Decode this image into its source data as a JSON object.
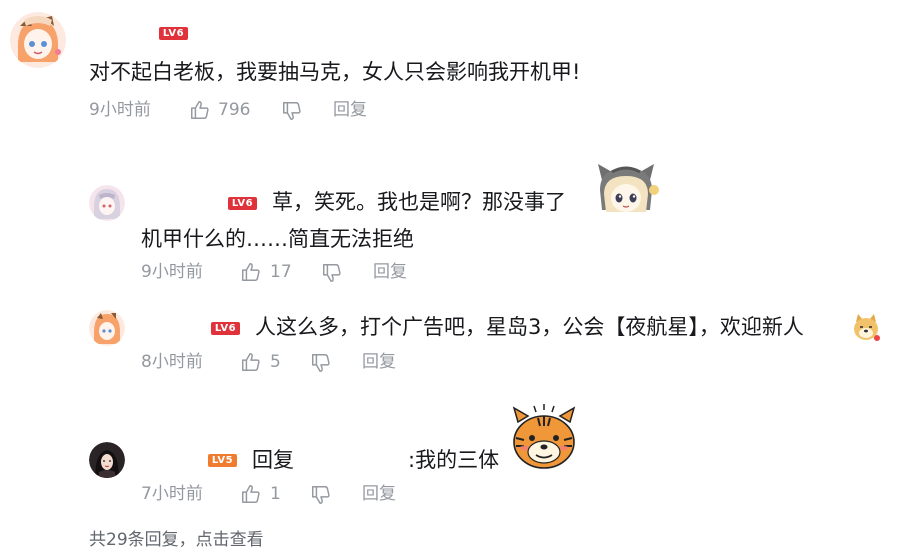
{
  "main_comment": {
    "level": "LV6",
    "text": "对不起白老板，我要抽马克，女人只会影响我开机甲!",
    "time": "9小时前",
    "likes": "796",
    "reply_label": "回复"
  },
  "replies": [
    {
      "level": "LV6",
      "text_line1": "草，笑死。我也是啊？那没事了",
      "text_line2": "机甲什么的……简直无法拒绝",
      "time": "9小时前",
      "likes": "17",
      "reply_label": "回复"
    },
    {
      "level": "LV6",
      "text": "人这么多，打个广告吧，星岛3，公会【夜航星】，欢迎新人",
      "time": "8小时前",
      "likes": "5",
      "reply_label": "回复"
    },
    {
      "level": "LV5",
      "reply_prefix": "回复",
      "text": ":我的三体",
      "time": "7小时前",
      "likes": "1",
      "reply_label": "回复"
    }
  ],
  "footer": {
    "total_replies": "共29条回复，",
    "view_link": "点击查看"
  },
  "colors": {
    "text": "#18191c",
    "meta": "#9499a0",
    "lv6": "#e0323a",
    "lv5": "#f07c30"
  }
}
